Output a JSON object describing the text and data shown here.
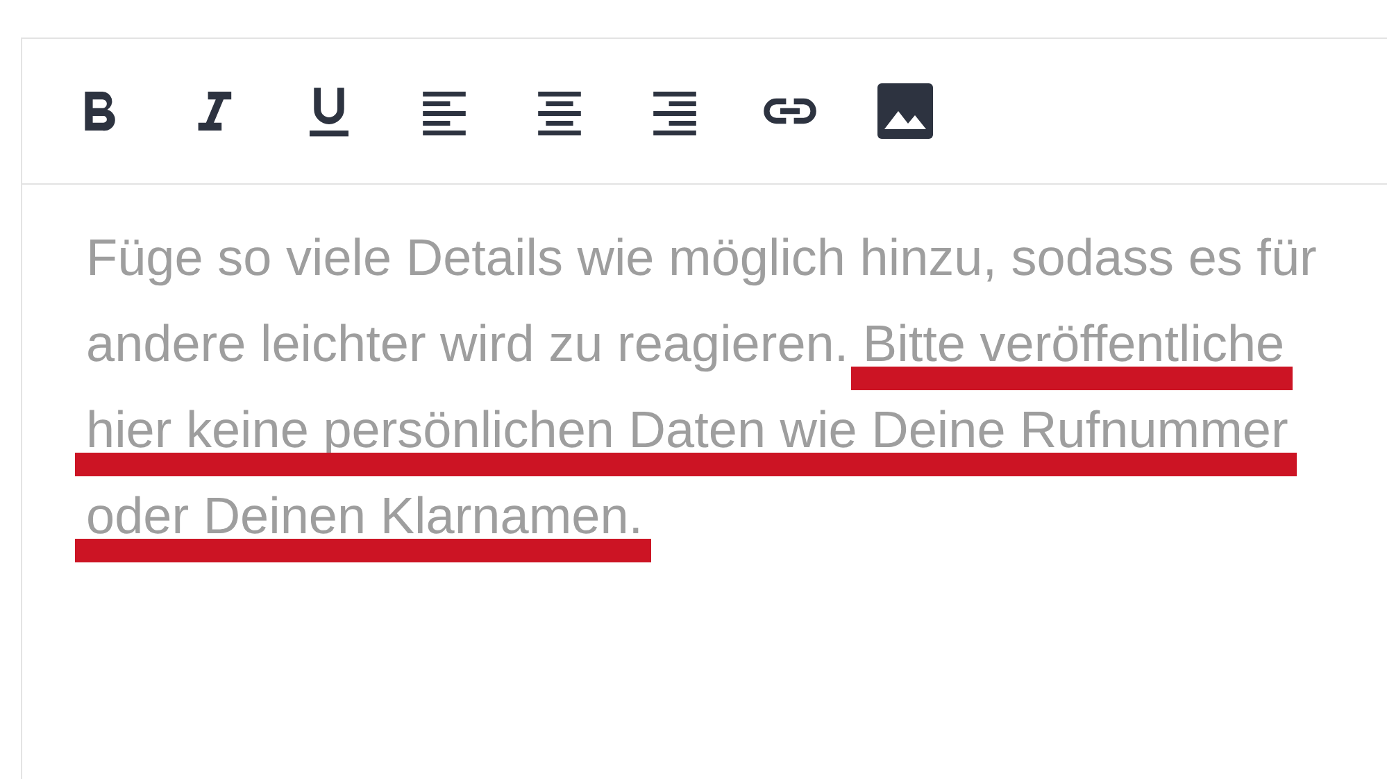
{
  "toolbar": [
    {
      "kind": "bold"
    },
    {
      "kind": "italic"
    },
    {
      "kind": "underline"
    },
    {
      "kind": "align-left"
    },
    {
      "kind": "align-center"
    },
    {
      "kind": "align-right"
    },
    {
      "kind": "link"
    },
    {
      "kind": "image"
    }
  ],
  "placeholder_lines": [
    [
      {
        "text": "Füge so viele Details wie möglich hinzu, sodass es für",
        "marked": false
      }
    ],
    [
      {
        "text": "andere leichter wird zu reagieren. ",
        "marked": false
      },
      {
        "text": "Bitte veröffentliche",
        "marked": true
      }
    ],
    [
      {
        "text": "hier keine persönlichen Daten wie Deine Rufnummer",
        "marked": true
      }
    ],
    [
      {
        "text": "oder Deinen Klarnamen.",
        "marked": true
      }
    ]
  ]
}
